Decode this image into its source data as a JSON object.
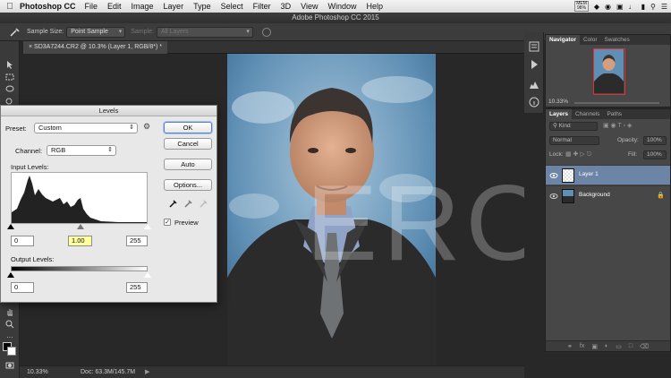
{
  "menubar": {
    "app_name": "Photoshop CC",
    "items": [
      "File",
      "Edit",
      "Image",
      "Layer",
      "Type",
      "Select",
      "Filter",
      "3D",
      "View",
      "Window",
      "Help"
    ],
    "mem_label": "MEM",
    "mem_value": "98%"
  },
  "window_title": "Adobe Photoshop CC 2015",
  "options_bar": {
    "sample_size_label": "Sample Size:",
    "sample_size_value": "Point Sample",
    "sample_label": "Sample:",
    "sample_value": "All Layers"
  },
  "document_tab": "SD3A7244.CR2 @ 10.3% (Layer 1, RGB/8*) *",
  "watermark": "ERO",
  "status_bar": {
    "zoom": "10.33%",
    "doc_info": "Doc: 63.3M/145.7M"
  },
  "navigator": {
    "tabs": [
      "Navigator",
      "Color",
      "Swatches"
    ],
    "zoom": "10.33%"
  },
  "layers_panel": {
    "tabs": [
      "Layers",
      "Channels",
      "Paths"
    ],
    "filter_value": "Kind",
    "blend_mode": "Normal",
    "opacity_label": "Opacity:",
    "opacity_value": "100%",
    "lock_label": "Lock:",
    "fill_label": "Fill:",
    "fill_value": "100%",
    "layers": [
      {
        "name": "Layer 1",
        "selected": true
      },
      {
        "name": "Background",
        "selected": false
      }
    ]
  },
  "levels_dialog": {
    "title": "Levels",
    "preset_label": "Preset:",
    "preset_value": "Custom",
    "channel_label": "Channel:",
    "channel_value": "RGB",
    "input_levels_label": "Input Levels:",
    "input_black": "0",
    "input_gamma": "1.00",
    "input_white": "255",
    "output_levels_label": "Output Levels:",
    "output_black": "0",
    "output_white": "255",
    "ok_label": "OK",
    "cancel_label": "Cancel",
    "auto_label": "Auto",
    "options_label": "Options...",
    "preview_label": "Preview",
    "preview_checked": true
  },
  "colors": {
    "accent": "#6c84a6",
    "gamma_highlight": "#ffffa0"
  }
}
